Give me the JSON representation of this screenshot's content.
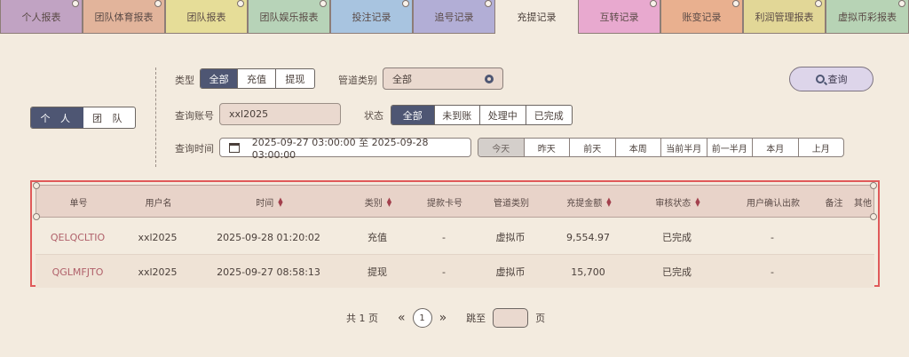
{
  "tabs": [
    {
      "label": "个人报表",
      "color": "#c1a3c3"
    },
    {
      "label": "团队体育报表",
      "color": "#e2b49b"
    },
    {
      "label": "团队报表",
      "color": "#e6dd98"
    },
    {
      "label": "团队娱乐报表",
      "color": "#b7d3b8"
    },
    {
      "label": "投注记录",
      "color": "#a8c4e0"
    },
    {
      "label": "追号记录",
      "color": "#b2aed6"
    },
    {
      "label": "充提记录",
      "color": "#f3ebdf"
    },
    {
      "label": "互转记录",
      "color": "#e8a9cf"
    },
    {
      "label": "账变记录",
      "color": "#e9b08f"
    },
    {
      "label": "利润管理报表",
      "color": "#e2d797"
    },
    {
      "label": "虚拟币彩报表",
      "color": "#b7d3b5"
    }
  ],
  "person_toggle": {
    "personal": "个 人",
    "team": "团 队"
  },
  "filters": {
    "type_label": "类型",
    "type_options": [
      "全部",
      "充值",
      "提现"
    ],
    "channel_label": "管道类别",
    "channel_value": "全部",
    "account_label": "查询账号",
    "account_value": "xxl2025",
    "status_label": "状态",
    "status_options": [
      "全部",
      "未到账",
      "处理中",
      "已完成"
    ],
    "time_label": "查询时间",
    "time_range": "2025-09-27 03:00:00 至 2025-09-28 03:00:00",
    "quick_ranges": [
      "今天",
      "昨天",
      "前天",
      "本周",
      "当前半月",
      "前一半月",
      "本月",
      "上月"
    ],
    "search_button": "查询"
  },
  "table": {
    "headers": [
      "单号",
      "用户名",
      "时间",
      "类别",
      "提款卡号",
      "管道类别",
      "充提金额",
      "审核状态",
      "用户确认出款",
      "备注",
      "其他"
    ],
    "rows": [
      [
        "QELQCLTIO",
        "xxl2025",
        "2025-09-28 01:20:02",
        "充值",
        "-",
        "虚拟币",
        "9,554.97",
        "已完成",
        "-",
        "",
        ""
      ],
      [
        "QGLMFJTO",
        "xxl2025",
        "2025-09-27 08:58:13",
        "提现",
        "-",
        "虚拟币",
        "15,700",
        "已完成",
        "-",
        "",
        ""
      ]
    ]
  },
  "pagination": {
    "total_pages": "共 1 页",
    "current": "1",
    "prev": "«",
    "next": "»",
    "jump_label": "跳至",
    "page_unit": "页"
  }
}
